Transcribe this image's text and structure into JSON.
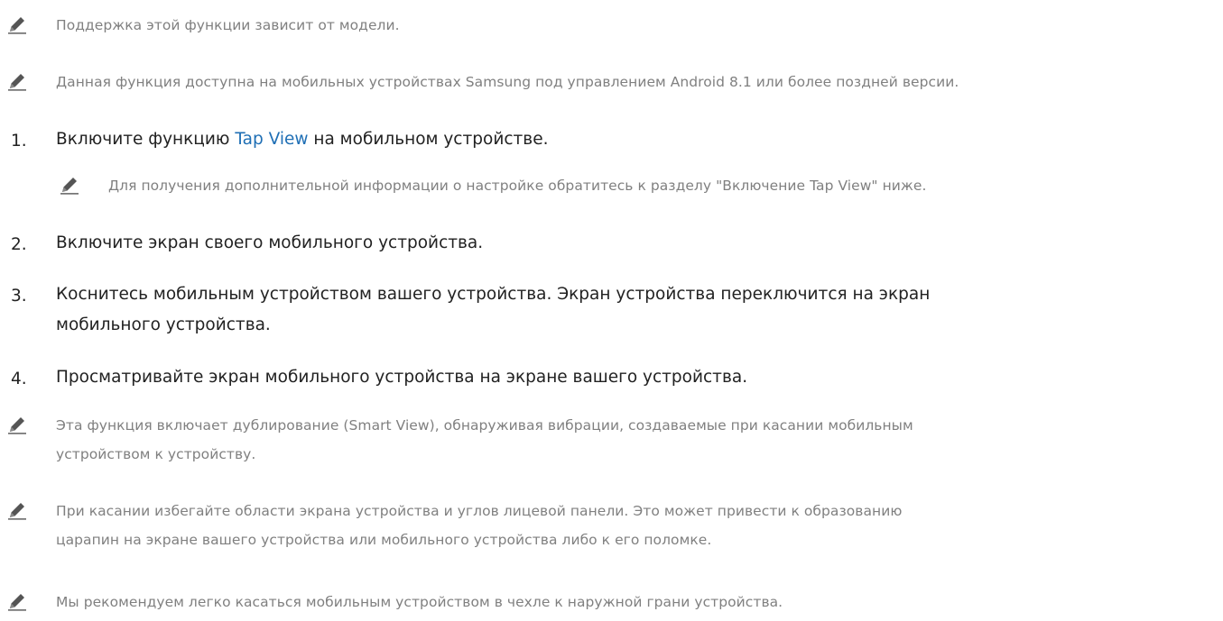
{
  "notes_top": [
    {
      "text": "Поддержка этой функции зависит от модели."
    },
    {
      "text": "Данная функция доступна на мобильных устройствах Samsung под управлением Android 8.1 или более поздней версии."
    }
  ],
  "steps": [
    {
      "number": "1.",
      "text_before": "Включите функцию ",
      "link_text": "Tap View",
      "text_after": " на мобильном устройстве."
    },
    {
      "number": "2.",
      "text": "Включите экран своего мобильного устройства."
    },
    {
      "number": "3.",
      "line1": "Коснитесь мобильным устройством вашего устройства. Экран устройства переключится на экран",
      "line2": "мобильного устройства."
    },
    {
      "number": "4.",
      "text": "Просматривайте экран мобильного устройства на экране вашего устройства."
    }
  ],
  "step1_note": {
    "text": "Для получения дополнительной информации о настройке обратитесь к разделу \"Включение Tap View\" ниже."
  },
  "notes_bottom": [
    {
      "line1": "Эта функция включает дублирование (Smart View), обнаруживая вибрации, создаваемые при касании мобильным",
      "line2": "устройством к устройству."
    },
    {
      "line1": "При касании избегайте области экрана устройства и углов лицевой панели. Это может привести к образованию",
      "line2": "царапин на экране вашего устройства или мобильного устройства либо к его поломке."
    },
    {
      "line1": "Мы рекомендуем легко касаться мобильным устройством в чехле к наружной грани устройства."
    }
  ],
  "colors": {
    "note_text": "#808080",
    "body_text": "#222222",
    "link": "#1f6fb5",
    "icon": "#555555"
  },
  "icons": {
    "note": "pencil-icon"
  }
}
